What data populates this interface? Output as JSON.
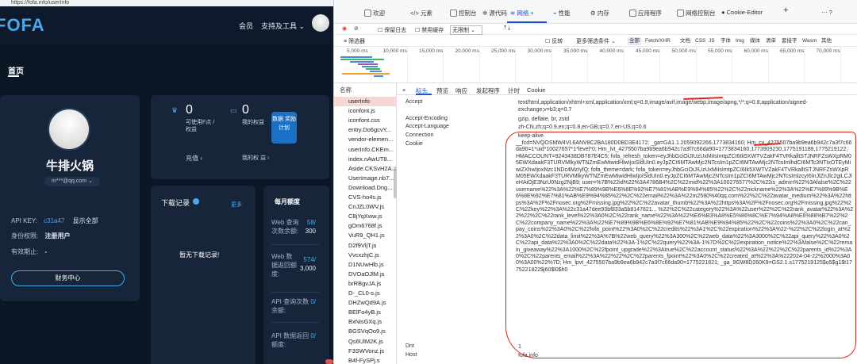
{
  "browser": {
    "url": "https://fofa.info/userInfo"
  },
  "fofa": {
    "logo": "FOFA",
    "nav": {
      "member": "会员",
      "tools": "支持及工具"
    },
    "home": "首页",
    "user": {
      "name": "牛排火锅",
      "email": "m***@qq.com"
    },
    "info": {
      "api_key_label": "API KEY:",
      "api_key_value": "c31a47",
      "show_all": "显示全部",
      "identity_label": "身份权限:",
      "identity_value": "注册用户",
      "valid_label": "有效期止:",
      "valid_value": "-"
    },
    "finance_button": "财务中心",
    "stats": {
      "f_points_num": "0",
      "f_points_label": "可使用F点 / 权益",
      "my_points_num": "0",
      "my_points_label": "我的权益",
      "recharge": "充值 ›",
      "my_rights": "我的权 益 ›"
    },
    "data_button": "数据 奖励 计划",
    "downloads": {
      "title": "下载记录",
      "more": "更多",
      "empty": "暂无下载记录!"
    },
    "quota": {
      "title": "每月额度",
      "items": [
        {
          "label": "Web 查询次数余额:",
          "value": "58/",
          "value2": "300"
        },
        {
          "label": "Web 数据返回额度:",
          "value": "574/",
          "value2": "3,000"
        },
        {
          "label": "API 查询次数余额:",
          "value": "0/"
        },
        {
          "label": "API 数据返回额度:",
          "value": "0/"
        }
      ]
    }
  },
  "devtools": {
    "tabs": [
      "欢迎",
      "元素",
      "控制台",
      "源代码",
      "网络",
      "性能",
      "内存",
      "应用程序",
      "网络控制台",
      "Cookie-Editor"
    ],
    "toolbar": {
      "preserve_log": "保留日志",
      "disable_cache": "禁用缓存",
      "throttle": "无限制"
    },
    "filter": {
      "placeholder": "筛选器",
      "invert": "反转",
      "more": "更多筛选条件",
      "chips": [
        "全部",
        "Fetch/XHR",
        "文档",
        "CSS",
        "JS",
        "字体",
        "Img",
        "媒体",
        "清单",
        "套接字",
        "Wasm",
        "其他"
      ]
    },
    "timeline_ticks": [
      "5,000 ms",
      "10,000 ms",
      "15,000 ms",
      "20,000 ms",
      "25,000 ms",
      "30,000 ms",
      "35,000 ms",
      "40,000 ms",
      "45,000 ms",
      "50,000 ms",
      "55,000 ms",
      "60,000 ms",
      "65,000 ms",
      "70,000 ms"
    ],
    "name_header": "名称",
    "files": [
      "userInfo",
      "iconfont.js",
      "iconfont.css",
      "entry.Do6gcvY...",
      "vendor-elemen...",
      "userInfo.CKEm...",
      "index.nAwUT8...",
      "Aside.CKSvH2A...",
      "UserImage.nb7...",
      "Download.Dng...",
      "CVS-ho4s.js",
      "CnJZL0WV.js",
      "C8jYqXww.js",
      "gOm6768f.js",
      "VuR9_QH1.js",
      "D2f9VljT.js",
      "VvcxzhjC.js",
      "D1NUwHlb.js",
      "DVOaOJlM.js",
      "brRBgvJA.js",
      "D-_CL0-s.js",
      "DHZwQd9A.js",
      "BElFo4yB.js",
      "BxNisGXq.js",
      "BGSVqOo9.js",
      "Qs6UlM2K.js",
      "F3SWVonz.js",
      "B4f-FySPj.s"
    ],
    "detail_tabs": [
      "×",
      "标头",
      "预览",
      "响应",
      "发起程序",
      "计时",
      "Cookie"
    ],
    "headers": [
      {
        "name": "Accept",
        "value": "text/html,application/xhtml+xml,application/xml;q=0.9,image/avif,image/webp,image/apng,*/*;q=0.8,application/signed-exchange;v=b3;q=0.7"
      },
      {
        "name": "Accept-Encoding",
        "value": "gzip, deflate, br, zstd"
      },
      {
        "name": "Accept-Language",
        "value": "zh-CN,zh;q=0.9,en;q=0.8,en-GB;q=0.7,en-US;q=0.6"
      },
      {
        "name": "Connection",
        "value": "keep-alive"
      },
      {
        "name": "Cookie",
        "value": ""
      }
    ],
    "cookie": "__fcd=NVQOSMW4VL6ANV8C2BA180D0BD3E4172; _ga=GA1.1.2059092266.1773834160; Hm_cv_4275507ba9b9ea6b942c7a3f7c66da90=1*uid*10027657*1*level*0; Hm_lvt_4275507ba9b9ea6b942c7a3f7c66da90=1773834160,1773909230,1775191189,1775219122; HMACCOUNT=9243438DB787E4C5; fofa_refresh_token=eyJhbGciOiJIUzUxMiIsImtpZCI6Ik5XWTVZakF4TVRkalltSTJNRFZsWXpRM05EWXdaakF3TURVMlkyWTNZmEwMiwidHlwIjoiSldUIn0.eyJpZCI6MTAwMjc2NTcsIm1pZCI6MTAwMjc2NTcsImlhdCI6MTc3NTIxOTEyMiwiZXhwIjoxNzc1NDc4MzIyfQ; fofa_theme=dark; fofa_token=eyJhbGciOiJIUzUxMiIsImtpZCI6Ik5XWTVZakF4TVRkalltSTJNRFZsWXpRM05EWXdaakF3TURVMlkyWTNZmEwMiwidHlwIjoiSldUIn0.eyJpZCI6MTAwMjc2NTcsIm1pZCI6MTAwMjc2NTcsImlzcyI6InJlZnJlc2giLCJleHAiOjE3NzU0Nzg2NjB9; user=%7B%22id%22%3A4786B4%2C%22mid%22%3A100276577%2C%22is_admin%22%3Afalse%2C%22username%22%3A%22%E7%89%9B%E6%8E%92%E7%81%AB%E9%94%85%22%2C%22nickname%22%3A%22%E7%89%9B%E6%8E%92%E7%81%AB%E9%94%85%22%2C%22email%22%3A%22m2580%40qq.com%22%2C%22avatar_medium%22%3A%22https%3A%2F%2Fnosec.org%2Fmissing.jpg%22%2C%22avatar_thumb%22%3A%22https%3A%2F%2Fnosec.org%2Fmissing.jpg%22%2C%22key%22%3A%22c31a47dee93bf833a5b8147821... %22%2C%22category%22%3A%22user%22%2C%22rank_avatar%22%3A%22%22%2C%22rank_level%22%3A0%2C%22rank_name%22%3A%22%E6%B3%A8%E5%86%8C%E7%94%A8%E6%88%B7%22%2C%22company_name%22%3A%22%E7%89%9B%E6%8E%92%E7%81%AB%E9%94%85%22%2C%22coins%22%3A0%2C%22can_pay_coins%22%3A0%2C%22fofa_point%22%3A0%2C%22credits%22%3A1%2C%22expiration%22%3A%22-%22%2C%22login_at%22%3A0%2C%22data_limit%22%3A%7B%22web_query%22%3A300%2C%22web_data%22%3A3000%2C%22api_query%22%3A0%2C%22api_data%22%3A0%2C%22data%22%3A-1%2C%22query%22%3A-1%7D%2C%22expiration_notice%22%3Afalse%2C%22remain_giveaway%22%3A1000%2C%22fpoint_upgrade%22%3Atrue%2C%22account_status%22%3A%22%22%2C%22parents_id%22%3A0%2C%22parents_email%22%3A%22%22%2C%22parents_fpoint%22%3A0%2C%22created_at%22%3A%222024-04-22%2000%3A00%3A00%22%7D; Hm_lpvt_4275507ba9b9ea6b942c7a3f7c66da90=1775221821; _ga_9GW8D260K9=GS2.1.s1775219125$o5$g1$t1775221822$j60$l0$h0",
    "headers_after": [
      {
        "name": "Dnt",
        "value": "1"
      },
      {
        "name": "Host",
        "value": "fofa.info"
      }
    ]
  }
}
